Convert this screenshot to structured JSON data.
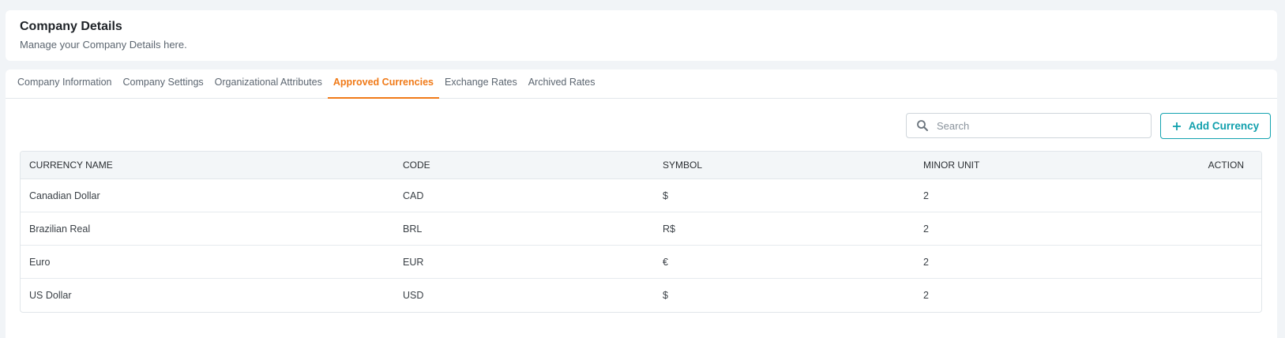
{
  "header": {
    "title": "Company Details",
    "subtitle": "Manage your Company Details here."
  },
  "tabs": [
    {
      "label": "Company Information",
      "active": false
    },
    {
      "label": "Company Settings",
      "active": false
    },
    {
      "label": "Organizational Attributes",
      "active": false
    },
    {
      "label": "Approved Currencies",
      "active": true
    },
    {
      "label": "Exchange Rates",
      "active": false
    },
    {
      "label": "Archived Rates",
      "active": false
    }
  ],
  "toolbar": {
    "search_placeholder": "Search",
    "search_value": "",
    "search_icon": "search-icon",
    "add_label": "Add Currency",
    "add_icon": "plus-icon"
  },
  "table": {
    "columns": [
      "CURRENCY NAME",
      "CODE",
      "SYMBOL",
      "MINOR UNIT",
      "ACTION"
    ],
    "rows": [
      {
        "name": "Canadian Dollar",
        "code": "CAD",
        "symbol": "$",
        "minor_unit": "2"
      },
      {
        "name": "Brazilian Real",
        "code": "BRL",
        "symbol": "R$",
        "minor_unit": "2"
      },
      {
        "name": "Euro",
        "code": "EUR",
        "symbol": "€",
        "minor_unit": "2"
      },
      {
        "name": "US Dollar",
        "code": "USD",
        "symbol": "$",
        "minor_unit": "2"
      }
    ]
  },
  "colors": {
    "active_tab": "#f07a18",
    "accent": "#14a3b0",
    "background": "#f1f4f7"
  }
}
